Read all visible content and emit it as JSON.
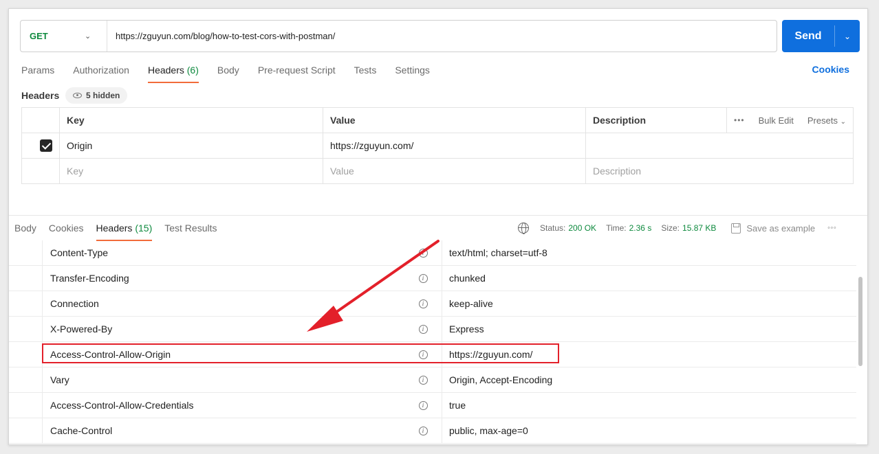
{
  "request": {
    "method": "GET",
    "url": "https://zguyun.com/blog/how-to-test-cors-with-postman/",
    "send_label": "Send"
  },
  "request_tabs": [
    {
      "label": "Params"
    },
    {
      "label": "Authorization"
    },
    {
      "label": "Headers",
      "count": "(6)"
    },
    {
      "label": "Body"
    },
    {
      "label": "Pre-request Script"
    },
    {
      "label": "Tests"
    },
    {
      "label": "Settings"
    }
  ],
  "cookies_link": "Cookies",
  "headers_section": {
    "label": "Headers",
    "hidden_label": "5 hidden"
  },
  "request_headers": {
    "columns": {
      "key": "Key",
      "value": "Value",
      "description": "Description"
    },
    "tools": {
      "bulk_edit": "Bulk Edit",
      "presets": "Presets"
    },
    "rows": [
      {
        "key": "Origin",
        "value": "https://zguyun.com/",
        "description": "",
        "checked": true
      }
    ],
    "placeholders": {
      "key": "Key",
      "value": "Value",
      "description": "Description"
    }
  },
  "response_tabs": [
    {
      "label": "Body"
    },
    {
      "label": "Cookies"
    },
    {
      "label": "Headers",
      "count": "(15)"
    },
    {
      "label": "Test Results"
    }
  ],
  "response_status": {
    "status_label": "Status:",
    "status": "200 OK",
    "time_label": "Time:",
    "time": "2.36 s",
    "size_label": "Size:",
    "size": "15.87 KB",
    "save_example": "Save as example"
  },
  "response_headers": [
    {
      "key": "Content-Type",
      "value": "text/html; charset=utf-8"
    },
    {
      "key": "Transfer-Encoding",
      "value": "chunked"
    },
    {
      "key": "Connection",
      "value": "keep-alive"
    },
    {
      "key": "X-Powered-By",
      "value": "Express"
    },
    {
      "key": "Access-Control-Allow-Origin",
      "value": "https://zguyun.com/"
    },
    {
      "key": "Vary",
      "value": "Origin, Accept-Encoding"
    },
    {
      "key": "Access-Control-Allow-Credentials",
      "value": "true"
    },
    {
      "key": "Cache-Control",
      "value": "public, max-age=0"
    }
  ],
  "colors": {
    "accent": "#0f6fde",
    "method_get": "#0e8a3e",
    "tab_underline": "#f26b3a",
    "annotation_red": "#e3202a"
  }
}
